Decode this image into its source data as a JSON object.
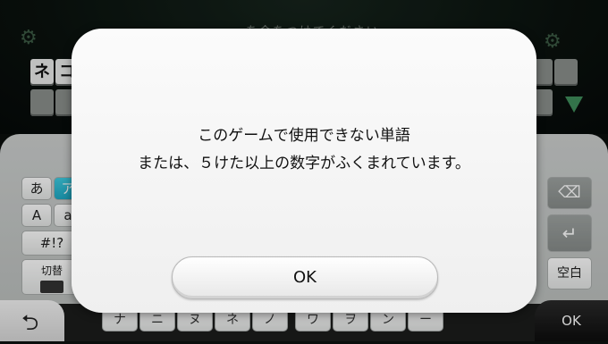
{
  "game": {
    "title_obscured": "・・・を会をつけてください",
    "tiles": [
      "ネ",
      "コ"
    ]
  },
  "keyboard": {
    "mode_keys": {
      "hiragana": "あ",
      "katakana": "ア",
      "alpha_upper": "A",
      "alpha_lower": "a",
      "symbols": "#!?",
      "switch": "切替"
    },
    "bottom_row": [
      "ナ",
      "ニ",
      "ヌ",
      "ネ",
      "ノ",
      "ワ",
      "ヲ",
      "ン",
      "ー"
    ],
    "space_label": "空白",
    "ok_label": "OK"
  },
  "dialog": {
    "message_line1": "このゲームで使用できない単語",
    "message_line2": "または、５けた以上の数字がふくまれています。",
    "ok_label": "OK"
  },
  "colors": {
    "accent_blue": "#1ea8c3",
    "dialog_bg": "#f5f5f5"
  },
  "icons": {
    "back": "back-arrow-icon",
    "delete": "backspace-icon",
    "enter": "enter-icon",
    "keyboard": "keyboard-icon"
  }
}
